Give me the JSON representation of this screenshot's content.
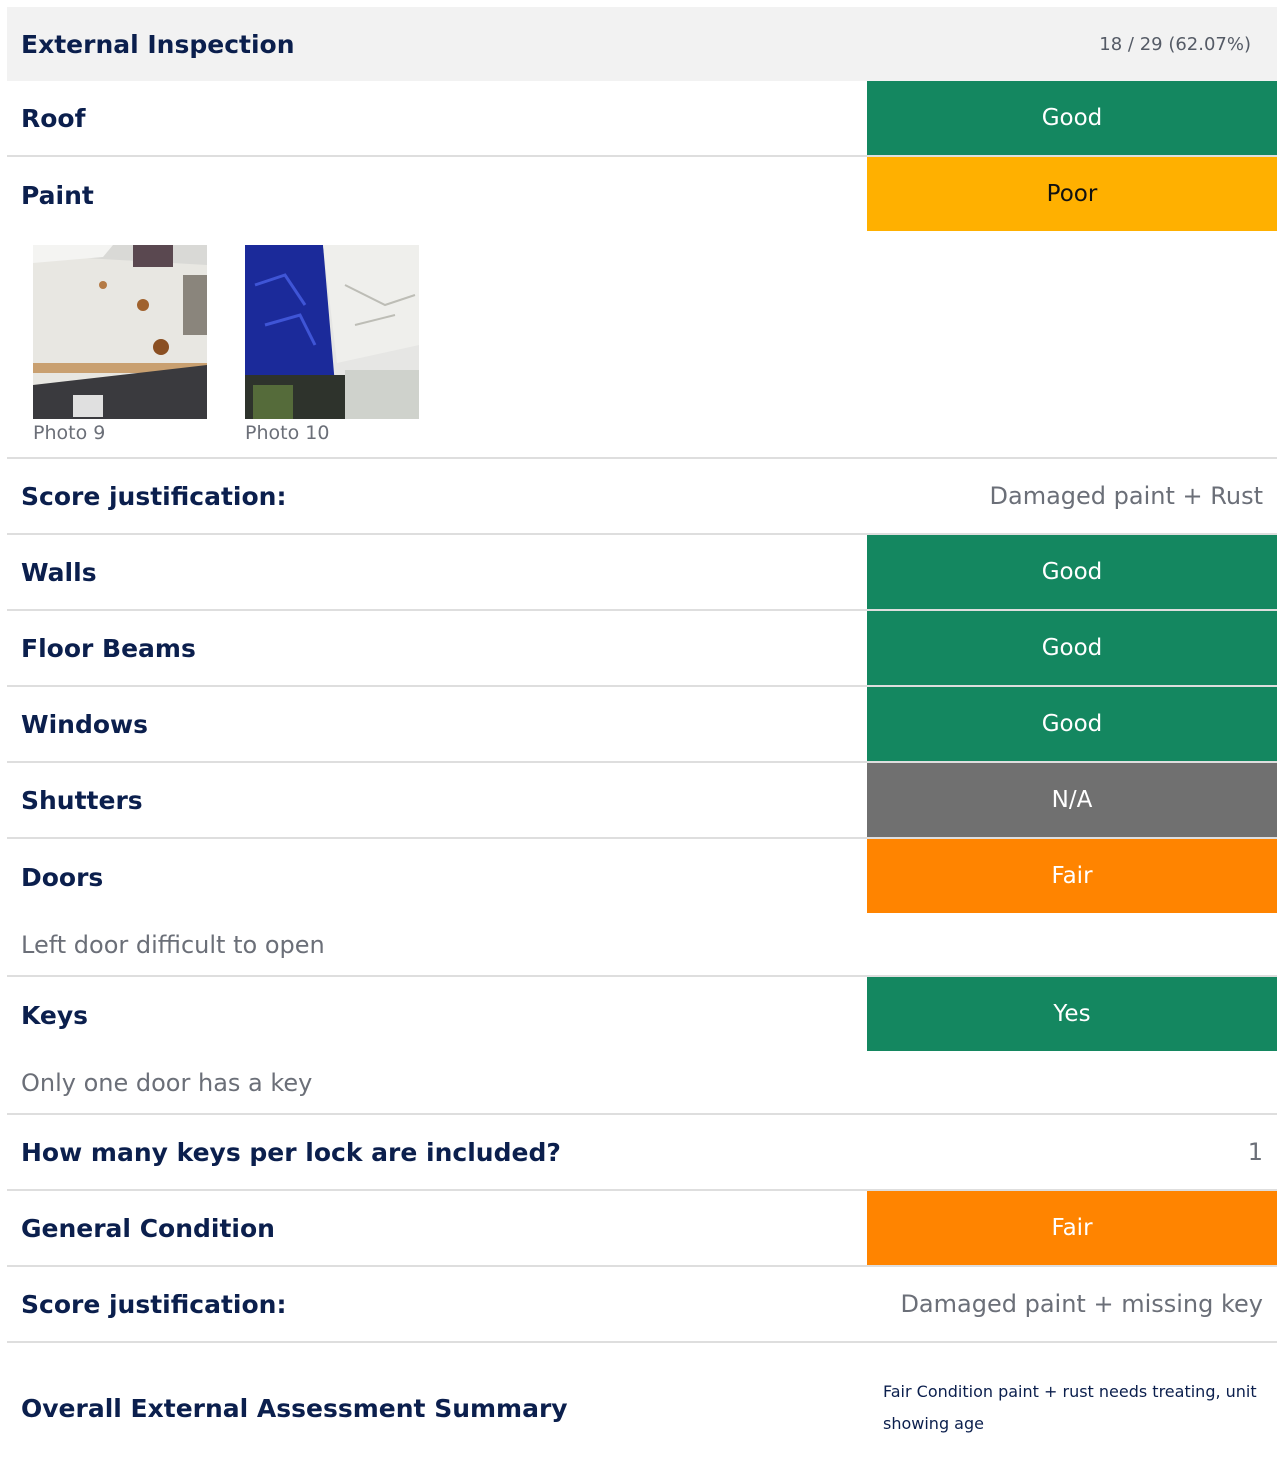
{
  "section": {
    "title": "External Inspection",
    "score": "18 / 29 (62.07%)"
  },
  "colors": {
    "Good": "#148760",
    "Poor": "#ffb000",
    "Fair": "#ff8400",
    "N/A": "#707070",
    "Yes": "#148760"
  },
  "items": {
    "roof": {
      "label": "Roof",
      "rating": "Good"
    },
    "paint": {
      "label": "Paint",
      "rating": "Poor"
    },
    "paint_photos": [
      {
        "caption": "Photo 9"
      },
      {
        "caption": "Photo 10"
      }
    ],
    "justification1": {
      "label": "Score justification:",
      "value": "Damaged paint + Rust"
    },
    "walls": {
      "label": "Walls",
      "rating": "Good"
    },
    "floor_beams": {
      "label": "Floor Beams",
      "rating": "Good"
    },
    "windows": {
      "label": "Windows",
      "rating": "Good"
    },
    "shutters": {
      "label": "Shutters",
      "rating": "N/A"
    },
    "doors": {
      "label": "Doors",
      "rating": "Fair",
      "note": "Left door difficult to open"
    },
    "keys": {
      "label": "Keys",
      "rating": "Yes",
      "note": "Only one door has a key"
    },
    "keys_per_lock": {
      "label": "How many keys per lock are included?",
      "value": "1"
    },
    "general_condition": {
      "label": "General Condition",
      "rating": "Fair"
    },
    "justification2": {
      "label": "Score justification:",
      "value": "Damaged paint + missing key"
    },
    "summary": {
      "label": "Overall External Assessment Summary",
      "value": "Fair Condition paint + rust needs treating, unit showing age"
    }
  }
}
